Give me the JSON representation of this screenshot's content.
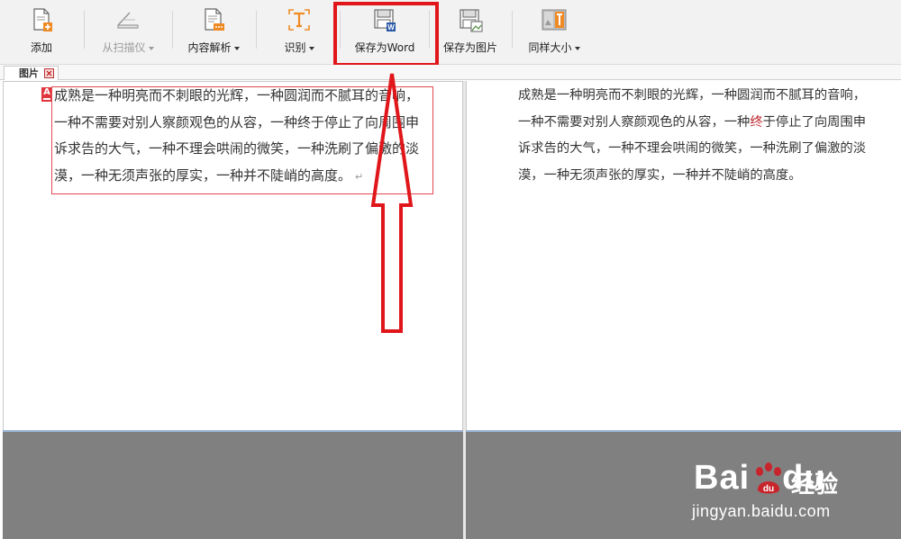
{
  "toolbar": {
    "buttons": [
      {
        "label": "添加",
        "has_dropdown": false,
        "disabled": false,
        "icon": "add-document-icon"
      },
      {
        "label": "从扫描仪",
        "has_dropdown": true,
        "disabled": true,
        "icon": "scanner-icon"
      },
      {
        "label": "内容解析",
        "has_dropdown": true,
        "disabled": false,
        "icon": "content-parse-icon"
      },
      {
        "label": "识别",
        "has_dropdown": true,
        "disabled": false,
        "icon": "recognize-text-icon"
      },
      {
        "label": "保存为Word",
        "has_dropdown": false,
        "disabled": false,
        "icon": "save-word-icon"
      },
      {
        "label": "保存为图片",
        "has_dropdown": false,
        "disabled": false,
        "icon": "save-image-icon"
      },
      {
        "label": "同样大小",
        "has_dropdown": true,
        "disabled": false,
        "icon": "same-size-icon"
      }
    ]
  },
  "tab": {
    "label": "图片"
  },
  "left_panel": {
    "lines": [
      "成熟是一种明亮而不刺眼的光辉，一种圆润而不腻耳的音响，",
      "一种不需要对别人察颜观色的从容，一种终于停止了向周围申",
      "诉求告的大气，一种不理会哄闹的微笑，一种洗刷了偏激的淡",
      "漠，一种无须声张的厚实，一种并不陡峭的高度。"
    ],
    "return_mark": "↵",
    "marker": "A"
  },
  "right_panel": {
    "lines": [
      "成熟是一种明亮而不刺眼的光辉，一种圆润而不腻耳的音响，",
      "一种不需要对别人察颜观色的从容，一种",
      "终",
      "于停止了向周围申",
      "诉求告的大气，一种不理会哄闹的微笑，一种洗刷了偏激的淡",
      "漠，一种无须声张的厚实，一种并不陡峭的高度。"
    ]
  },
  "watermark": {
    "brand": "Bai",
    "brand2": "du",
    "cn": "经验",
    "url": "jingyan.baidu.com"
  },
  "colors": {
    "highlight": "#e0161b",
    "toolbar_bg": "#f2f2f2",
    "gray_area": "#808080"
  }
}
